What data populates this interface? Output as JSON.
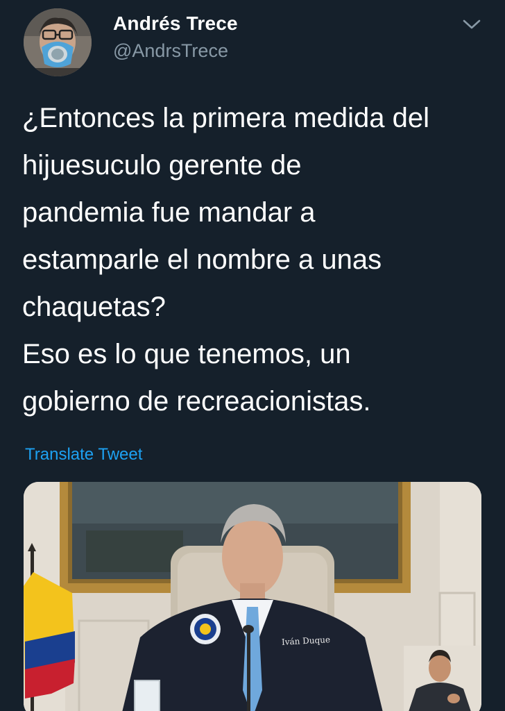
{
  "author": {
    "display_name": "Andrés Trece",
    "handle": "@AndrsTrece",
    "avatar_icon": "avatar-person-with-respirator"
  },
  "menu": {
    "icon": "chevron-down-icon"
  },
  "tweet": {
    "lines": [
      "¿Entonces la primera medida del",
      "hijuesuculo gerente de",
      "pandemia fue mandar a",
      "estamparle el nombre a unas",
      "chaquetas?",
      "Eso es lo que tenemos, un",
      "gobierno de recreacionistas."
    ],
    "translate_label": "Translate Tweet"
  },
  "media": {
    "jacket_label": "Iván Duque"
  },
  "colors": {
    "background": "#15202b",
    "text_primary": "#ffffff",
    "text_secondary": "#8899a6",
    "link": "#1da1f2"
  }
}
